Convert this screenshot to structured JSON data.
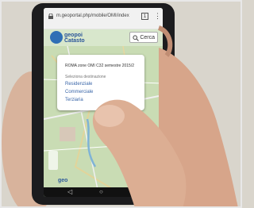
{
  "browser": {
    "url": "m.geoportal.php/mobile/OMI/index",
    "tabs_count": "1",
    "menu_icon": "more-vert-icon"
  },
  "app": {
    "logo_text_top": "geopoi",
    "logo_text_bottom": "Catasto",
    "search_label": "Cerca"
  },
  "popup": {
    "title": "ROMA zone OMI C32 semestre 2015/2",
    "subtitle": "Seleziona destinazione",
    "options": [
      "Residenziale",
      "Commerciale",
      "Terziaria"
    ]
  },
  "footer": {
    "brand": "geo"
  },
  "colors": {
    "map_green": "#b8d3a3",
    "link_blue": "#3a66a8",
    "skin": "#d7a58a"
  }
}
